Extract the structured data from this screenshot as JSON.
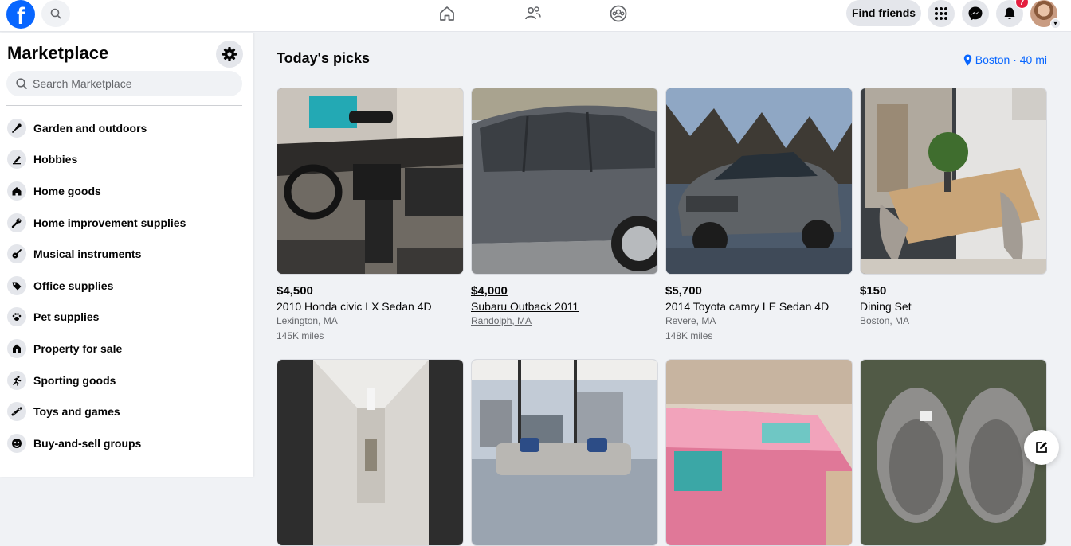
{
  "topbar": {
    "logo_letter": "f",
    "nav": [
      "home-icon",
      "friends-icon",
      "groups-icon"
    ],
    "find_friends_label": "Find friends",
    "notifications_badge": "7"
  },
  "sidebar": {
    "title": "Marketplace",
    "search_placeholder": "Search Marketplace",
    "items": [
      {
        "label": "Garden and outdoors",
        "icon": "trowel-icon"
      },
      {
        "label": "Hobbies",
        "icon": "brush-icon"
      },
      {
        "label": "Home goods",
        "icon": "house-icon"
      },
      {
        "label": "Home improvement supplies",
        "icon": "wrench-icon"
      },
      {
        "label": "Musical instruments",
        "icon": "guitar-icon"
      },
      {
        "label": "Office supplies",
        "icon": "tag-icon"
      },
      {
        "label": "Pet supplies",
        "icon": "paw-icon"
      },
      {
        "label": "Property for sale",
        "icon": "building-icon"
      },
      {
        "label": "Sporting goods",
        "icon": "runner-icon"
      },
      {
        "label": "Toys and games",
        "icon": "game-icon"
      },
      {
        "label": "Buy-and-sell groups",
        "icon": "group-icon"
      }
    ]
  },
  "main": {
    "section_title": "Today's picks",
    "location": "Boston · 40 mi",
    "listings": [
      {
        "price": "$4,500",
        "title": "2010 Honda civic LX Sedan 4D",
        "location": "Lexington, MA",
        "miles": "145K miles"
      },
      {
        "price": "$4,000",
        "title": "Subaru Outback 2011",
        "location": "Randolph, MA",
        "miles": ""
      },
      {
        "price": "$5,700",
        "title": "2014 Toyota camry LE Sedan 4D",
        "location": "Revere, MA",
        "miles": "148K miles"
      },
      {
        "price": "$150",
        "title": "Dining Set",
        "location": "Boston, MA",
        "miles": ""
      },
      {
        "price": "",
        "title": "",
        "location": "",
        "miles": ""
      },
      {
        "price": "",
        "title": "",
        "location": "",
        "miles": ""
      },
      {
        "price": "",
        "title": "",
        "location": "",
        "miles": ""
      },
      {
        "price": "",
        "title": "",
        "location": "",
        "miles": ""
      }
    ]
  },
  "colors": {
    "brand": "#0866ff",
    "badge": "#e41e3f"
  }
}
